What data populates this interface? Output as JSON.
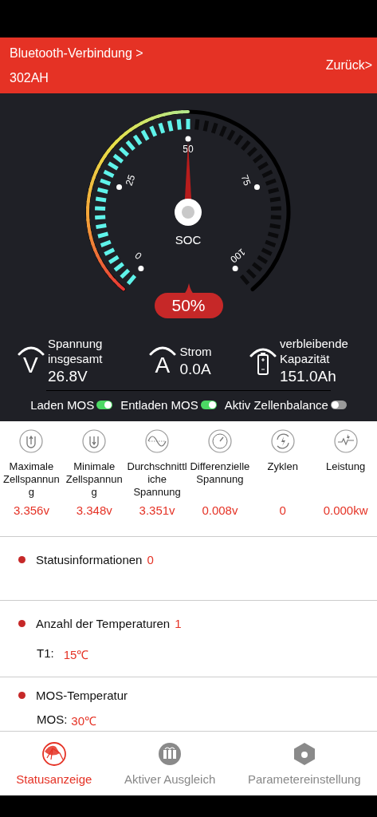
{
  "header": {
    "bluetooth_link": "Bluetooth-Verbindung >",
    "device_name": "302AH",
    "back_button": "Zurück>"
  },
  "gauge": {
    "ticks": [
      "0",
      "25",
      "50",
      "75",
      "100"
    ],
    "center_label": "SOC",
    "reading": "50%"
  },
  "metrics": [
    {
      "kind": "voltage",
      "symbol": "V",
      "label": "Spannung insgesamt",
      "value": "26.8V"
    },
    {
      "kind": "current",
      "symbol": "A",
      "label": "Strom",
      "value": "0.0A"
    },
    {
      "kind": "capacity",
      "label": "verbleibende Kapazität",
      "value": "151.0Ah"
    }
  ],
  "switches": [
    {
      "label": "Laden MOS",
      "on": true
    },
    {
      "label": "Entladen MOS",
      "on": true
    },
    {
      "label": "Aktiv Zellenbalance",
      "on": false
    }
  ],
  "stats": [
    {
      "kind": "max-cell",
      "label": "Maximale Zellspannung",
      "value": "3.356v"
    },
    {
      "kind": "min-cell",
      "label": "Minimale Zellspannung",
      "value": "3.348v"
    },
    {
      "kind": "average",
      "label": "Durchschnittliche Spannung",
      "value": "3.351v"
    },
    {
      "kind": "difference",
      "label": "Differenzielle Spannung",
      "value": "0.008v"
    },
    {
      "kind": "cycles",
      "label": "Zyklen",
      "value": "0"
    },
    {
      "kind": "power",
      "label": "Leistung",
      "value": "0.000kw"
    }
  ],
  "sections": [
    {
      "title": "Statusinformationen",
      "count": "0"
    },
    {
      "title": "Anzahl der Temperaturen",
      "count": "1",
      "readings": [
        {
          "label": "T1:",
          "value": "15℃"
        }
      ]
    },
    {
      "title": "MOS-Temperatur",
      "readings": [
        {
          "label": "MOS:",
          "value": "30℃"
        }
      ]
    }
  ],
  "nav": [
    {
      "kind": "status",
      "label": "Statusanzeige",
      "selected": true
    },
    {
      "kind": "balance",
      "label": "Aktiver Ausgleich",
      "selected": false
    },
    {
      "kind": "settings",
      "label": "Parametereinstellung",
      "selected": false
    }
  ]
}
